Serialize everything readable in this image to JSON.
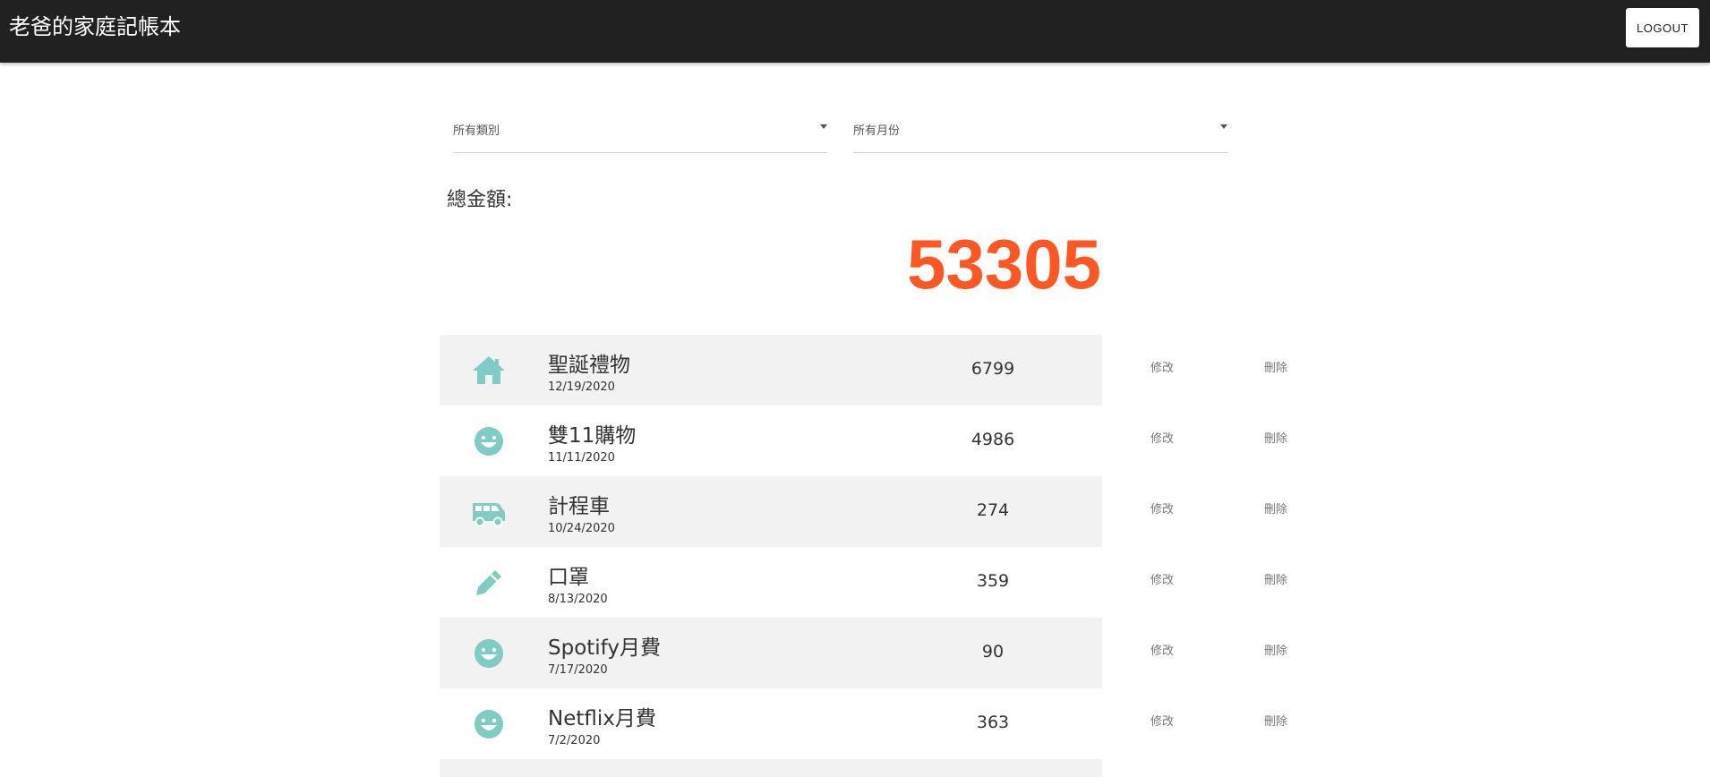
{
  "header": {
    "title": "老爸的家庭記帳本",
    "logout_label": "LOGOUT"
  },
  "filters": {
    "category": {
      "selected": "所有類別"
    },
    "month": {
      "selected": "所有月份"
    }
  },
  "summary": {
    "total_label": "總金額:",
    "total_value": "53305",
    "total_color": "#ff5722"
  },
  "theme": {
    "icon_color": "#80cbc4",
    "appbar_color": "#212121",
    "row_shade": "#f2f2f2"
  },
  "records": [
    {
      "icon": "home-icon",
      "name": "聖誕禮物",
      "date": "12/19/2020",
      "amount": "6799",
      "edit_label": "修改",
      "delete_label": "刪除"
    },
    {
      "icon": "smile-icon",
      "name": "雙11購物",
      "date": "11/11/2020",
      "amount": "4986",
      "edit_label": "修改",
      "delete_label": "刪除"
    },
    {
      "icon": "shuttle-van-icon",
      "name": "計程車",
      "date": "10/24/2020",
      "amount": "274",
      "edit_label": "修改",
      "delete_label": "刪除"
    },
    {
      "icon": "pen-icon",
      "name": "口罩",
      "date": "8/13/2020",
      "amount": "359",
      "edit_label": "修改",
      "delete_label": "刪除"
    },
    {
      "icon": "smile-icon",
      "name": "Spotify月費",
      "date": "7/17/2020",
      "amount": "90",
      "edit_label": "修改",
      "delete_label": "刪除"
    },
    {
      "icon": "smile-icon",
      "name": "Netflix月費",
      "date": "7/2/2020",
      "amount": "363",
      "edit_label": "修改",
      "delete_label": "刪除"
    }
  ]
}
